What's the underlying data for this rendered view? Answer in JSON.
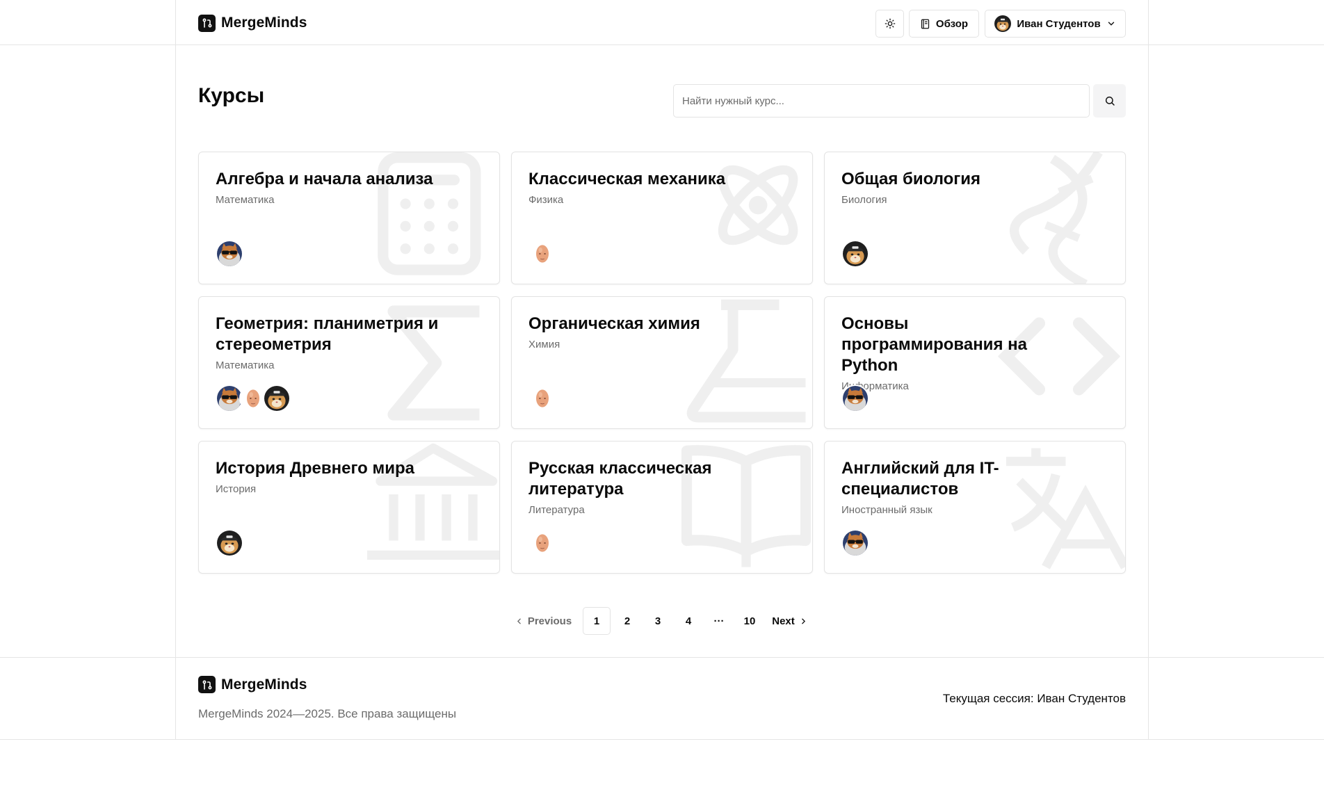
{
  "header": {
    "brand": "MergeMinds",
    "theme_toggle_icon": "sun-icon",
    "overview_label": "Обзор",
    "user_name": "Иван Студентов"
  },
  "page": {
    "title": "Курсы",
    "search_placeholder": "Найти нужный курс..."
  },
  "courses": [
    {
      "title": "Алгебра и начала анализа",
      "subject": "Математика",
      "icon": "calculator-icon",
      "teachers": [
        "cat-sunglasses"
      ]
    },
    {
      "title": "Классическая механика",
      "subject": "Физика",
      "icon": "atom-icon",
      "teachers": [
        "bald-head"
      ]
    },
    {
      "title": "Общая биология",
      "subject": "Биология",
      "icon": "dna-icon",
      "teachers": [
        "cat-cap"
      ]
    },
    {
      "title": "Геометрия: планиметрия и стереометрия",
      "subject": "Математика",
      "icon": "sigma-icon",
      "teachers": [
        "cat-sunglasses",
        "bald-head",
        "cat-cap"
      ]
    },
    {
      "title": "Органическая химия",
      "subject": "Химия",
      "icon": "flask-icon",
      "teachers": [
        "bald-head"
      ]
    },
    {
      "title": "Основы программирования на Python",
      "subject": "Информатика",
      "icon": "code-icon",
      "teachers": [
        "cat-sunglasses"
      ]
    },
    {
      "title": "История Древнего мира",
      "subject": "История",
      "icon": "landmark-icon",
      "teachers": [
        "cat-cap"
      ]
    },
    {
      "title": "Русская классическая литература",
      "subject": "Литература",
      "icon": "book-icon",
      "teachers": [
        "bald-head"
      ]
    },
    {
      "title": "Английский для IT-специалистов",
      "subject": "Иностранный язык",
      "icon": "languages-icon",
      "teachers": [
        "cat-sunglasses"
      ]
    }
  ],
  "pagination": {
    "previous": "Previous",
    "pages": [
      "1",
      "2",
      "3",
      "4"
    ],
    "ellipsis": "···",
    "last": "10",
    "next": "Next",
    "current": "1"
  },
  "footer": {
    "brand": "MergeMinds",
    "copyright": "MergeMinds 2024—2025. Все права защищены",
    "session": "Текущая сессия: Иван Студентов"
  }
}
